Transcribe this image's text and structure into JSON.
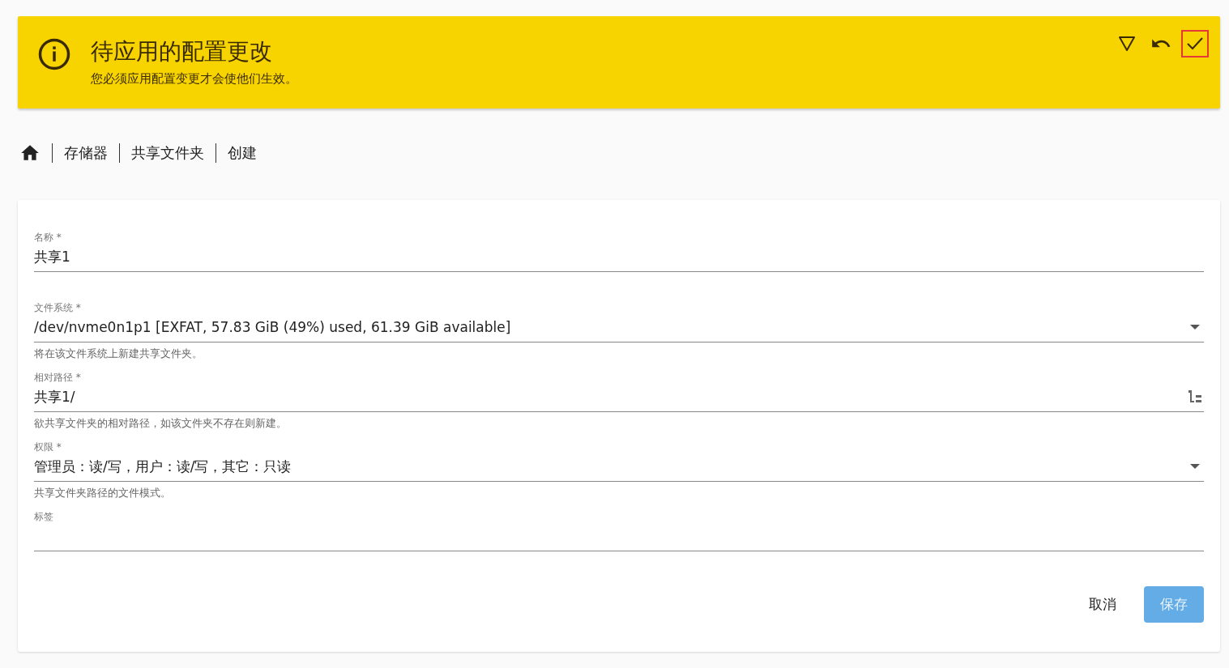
{
  "banner": {
    "title": "待应用的配置更改",
    "message": "您必须应用配置变更才会使他们生效。",
    "actions": [
      {
        "kind": "details",
        "highlighted": false
      },
      {
        "kind": "undo",
        "highlighted": false
      },
      {
        "kind": "apply",
        "highlighted": true
      }
    ]
  },
  "breadcrumb": [
    {
      "kind": "home"
    },
    {
      "label": "存储器"
    },
    {
      "label": "共享文件夹"
    },
    {
      "label": "创建"
    }
  ],
  "form": {
    "fields": [
      {
        "kind": "text",
        "label": "名称 *",
        "value": "共享1"
      },
      {
        "kind": "select",
        "label": "文件系统 *",
        "value": "/dev/nvme0n1p1 [EXFAT, 57.83 GiB (49%) used, 61.39 GiB available]",
        "hint": "将在该文件系统上新建共享文件夹。"
      },
      {
        "kind": "path",
        "label": "相对路径 *",
        "value": "共享1/",
        "hint": "欲共享文件夹的相对路径，如该文件夹不存在则新建。"
      },
      {
        "kind": "select",
        "label": "权限 *",
        "value": "管理员：读/写，用户：读/写，其它：只读",
        "hint": "共享文件夹路径的文件模式。"
      },
      {
        "kind": "text",
        "label": "标签"
      }
    ],
    "buttons": [
      {
        "kind": "cancel",
        "label": "取消",
        "disabled": false
      },
      {
        "kind": "save",
        "label": "保存",
        "disabled": true
      }
    ]
  }
}
